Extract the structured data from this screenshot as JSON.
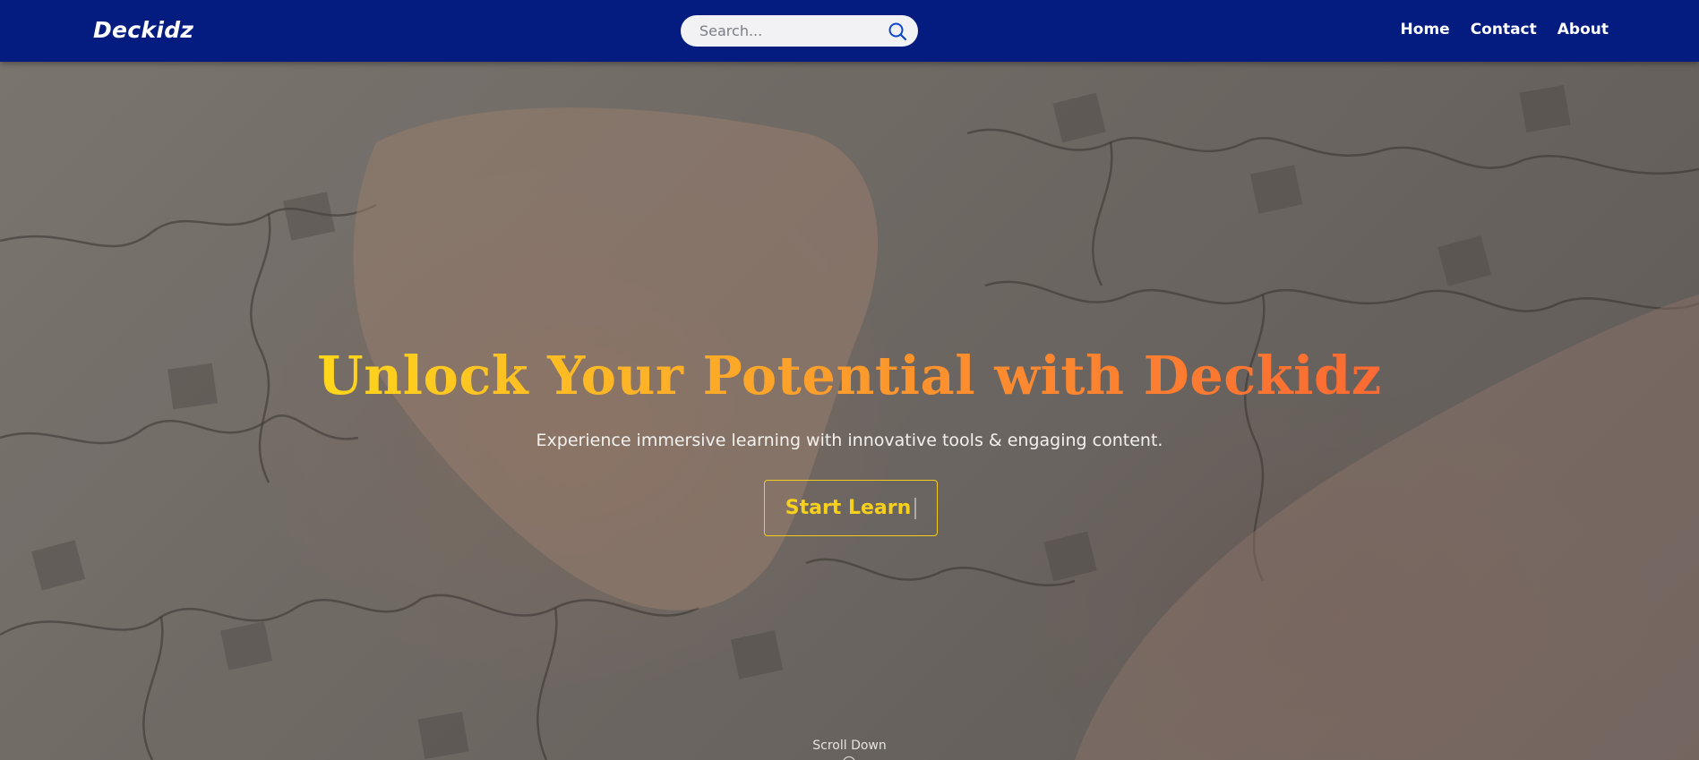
{
  "navbar": {
    "brand": "Deckidz",
    "search": {
      "placeholder": "Search...",
      "value": ""
    },
    "links": [
      "Home",
      "Contact",
      "About"
    ]
  },
  "hero": {
    "title": "Unlock Your Potential with Deckidz",
    "subtitle": "Experience immersive learning with innovative tools & engaging content.",
    "cta_label": "Start Learn",
    "scroll_label": "Scroll Down"
  },
  "colors": {
    "navbar_bg": "#041c80",
    "title_gradient_start": "#ffd71c",
    "title_gradient_end": "#fb6a33",
    "cta_accent": "#f7d01c"
  },
  "icons": {
    "search": "search-icon",
    "scroll": "scroll-mouse-icon"
  }
}
